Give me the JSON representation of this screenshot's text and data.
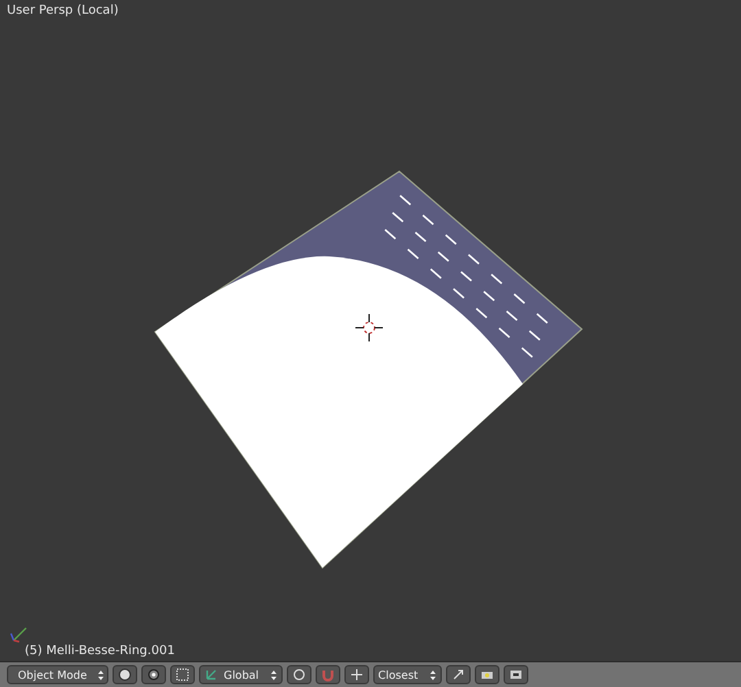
{
  "viewport": {
    "title": "User Persp (Local)",
    "object_label": "(5) Melli-Besse-Ring.001"
  },
  "header": {
    "mode": "Object Mode",
    "orientation": "Global",
    "snap_target": "Closest"
  }
}
